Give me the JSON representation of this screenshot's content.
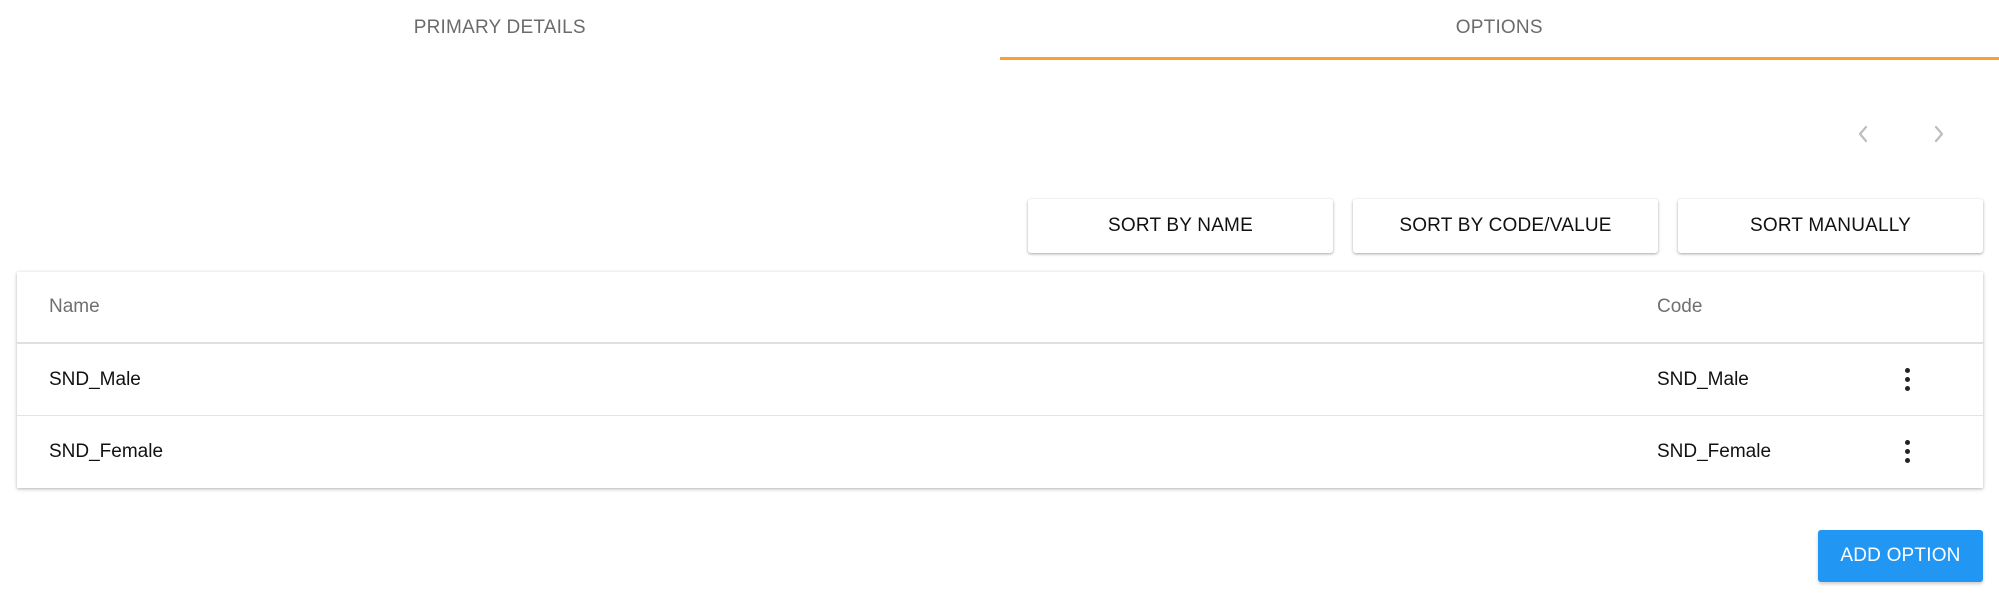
{
  "tabs": [
    {
      "label": "PRIMARY DETAILS",
      "active": false
    },
    {
      "label": "OPTIONS",
      "active": true
    }
  ],
  "colors": {
    "tab_indicator": "#ff9f2f",
    "primary_button": "#2196f3",
    "pager_icon": "#bdbdbd"
  },
  "pager": {
    "prev_icon": "chevron-left-icon",
    "next_icon": "chevron-right-icon"
  },
  "sort_buttons": {
    "by_name": "SORT BY NAME",
    "by_code": "SORT BY CODE/VALUE",
    "manual": "SORT MANUALLY"
  },
  "table": {
    "headers": {
      "name": "Name",
      "code": "Code"
    },
    "rows": [
      {
        "name": "SND_Male",
        "code": "SND_Male",
        "menu_icon": "more-vertical-icon"
      },
      {
        "name": "SND_Female",
        "code": "SND_Female",
        "menu_icon": "more-vertical-icon"
      }
    ]
  },
  "actions": {
    "add_option": "ADD OPTION"
  }
}
